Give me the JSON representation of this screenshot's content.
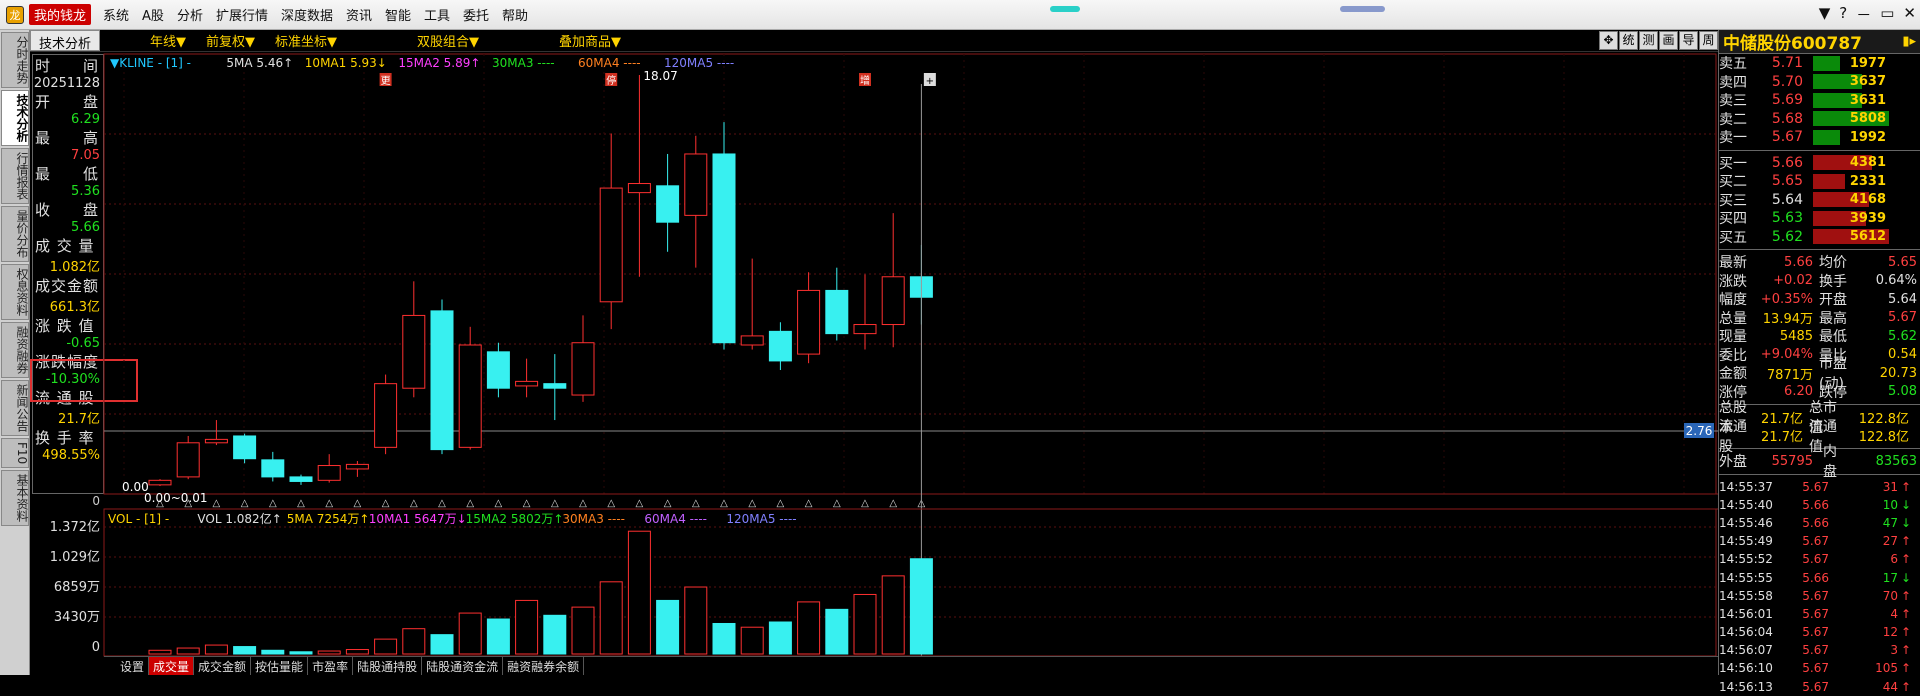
{
  "menubar": {
    "brand": "我的钱龙",
    "items": [
      "系统",
      "A股",
      "分析",
      "扩展行情",
      "深度数据",
      "资讯",
      "智能",
      "工具",
      "委托",
      "帮助"
    ],
    "window_controls": [
      "▼",
      "?",
      "－",
      "▭",
      "✕"
    ]
  },
  "sidetabs": [
    "分时走势",
    "技术分析",
    "行情报表",
    "量价分布",
    "权息资料",
    "融资融券",
    "新闻公告",
    "F10",
    "基本资料"
  ],
  "toolbar": {
    "tab": "技术分析",
    "items": [
      "年线▼",
      "前复权▼",
      "标准坐标▼",
      "双股组合▼",
      "叠加商品▼"
    ],
    "tools": [
      "✥",
      "统",
      "测",
      "画",
      "导",
      "周"
    ]
  },
  "info": [
    {
      "label": "时　　间",
      "value": "20251128",
      "color": "#e0e0e0"
    },
    {
      "label": "开　　盘",
      "value": "6.29",
      "color": "#20e020"
    },
    {
      "label": "最　　高",
      "value": "7.05",
      "color": "#ff4040"
    },
    {
      "label": "最　　低",
      "value": "5.36",
      "color": "#20e020"
    },
    {
      "label": "收　　盘",
      "value": "5.66",
      "color": "#20e020"
    },
    {
      "label": "成 交 量",
      "value": "1.082亿",
      "color": "#ffd400"
    },
    {
      "label": "成交金额",
      "value": "661.3亿",
      "color": "#ffd400"
    },
    {
      "label": "涨 跌 值",
      "value": "-0.65",
      "color": "#20e020"
    },
    {
      "label": "涨跌幅度",
      "value": "-10.30%",
      "color": "#20e020"
    },
    {
      "label": "流 通 股",
      "value": "21.7亿",
      "color": "#ffd400"
    },
    {
      "label": "换 手 率",
      "value": "498.55%",
      "color": "#ffd400"
    }
  ],
  "kline_legend": [
    {
      "text": "▼KLINE - [1] -",
      "color": "#20c8ff"
    },
    {
      "text": "5MA 5.46↑",
      "color": "#e0e0e0"
    },
    {
      "text": "10MA1 5.93↓",
      "color": "#ffd400"
    },
    {
      "text": "15MA2 5.89↑",
      "color": "#ff40ff"
    },
    {
      "text": "30MA3 ----",
      "color": "#20e020"
    },
    {
      "text": "60MA4 ----",
      "color": "#ff8020"
    },
    {
      "text": "120MA5 ----",
      "color": "#8080ff"
    }
  ],
  "vol_legend": [
    {
      "text": "VOL - [1] -",
      "color": "#ffd400"
    },
    {
      "text": "VOL 1.082亿↑",
      "color": "#e0e0e0"
    },
    {
      "text": "5MA 7254万↑",
      "color": "#ffd400"
    },
    {
      "text": "10MA1 5647万↓",
      "color": "#ff40ff"
    },
    {
      "text": "15MA2 5802万↑",
      "color": "#20e020"
    },
    {
      "text": "30MA3 ----",
      "color": "#ff8020"
    },
    {
      "text": "60MA4 ----",
      "color": "#c060ff"
    },
    {
      "text": "120MA5 ----",
      "color": "#8080ff"
    }
  ],
  "chart_data": {
    "type": "candlestick",
    "price_labels": {
      "peak": "18.07",
      "current": "2.76",
      "low": "0.00",
      "low2": "0.00~0.01",
      "axis_zero": "0"
    },
    "markers": [
      "更",
      "停",
      "增",
      "+"
    ],
    "candles": [
      {
        "o": 0.05,
        "c": 0.25,
        "h": 0.3,
        "l": 0.0
      },
      {
        "o": 0.4,
        "c": 1.9,
        "h": 2.2,
        "l": 0.3
      },
      {
        "o": 1.9,
        "c": 2.05,
        "h": 2.9,
        "l": 1.8
      },
      {
        "o": 2.2,
        "c": 1.2,
        "h": 2.3,
        "l": 1.0
      },
      {
        "o": 1.15,
        "c": 0.4,
        "h": 1.5,
        "l": 0.2
      },
      {
        "o": 0.4,
        "c": 0.2,
        "h": 0.5,
        "l": 0.05
      },
      {
        "o": 0.25,
        "c": 0.9,
        "h": 1.4,
        "l": 0.15
      },
      {
        "o": 0.75,
        "c": 0.95,
        "h": 1.1,
        "l": 0.4
      },
      {
        "o": 1.7,
        "c": 4.5,
        "h": 4.9,
        "l": 1.4
      },
      {
        "o": 4.3,
        "c": 7.5,
        "h": 9.0,
        "l": 3.9
      },
      {
        "o": 7.7,
        "c": 1.6,
        "h": 8.2,
        "l": 1.4
      },
      {
        "o": 1.7,
        "c": 6.2,
        "h": 7.0,
        "l": 1.6
      },
      {
        "o": 5.9,
        "c": 4.3,
        "h": 6.3,
        "l": 3.9
      },
      {
        "o": 4.4,
        "c": 4.6,
        "h": 5.6,
        "l": 3.9
      },
      {
        "o": 4.5,
        "c": 4.3,
        "h": 5.8,
        "l": 2.9
      },
      {
        "o": 4.0,
        "c": 6.3,
        "h": 7.5,
        "l": 3.7
      },
      {
        "o": 8.1,
        "c": 13.1,
        "h": 15.5,
        "l": 6.9
      },
      {
        "o": 12.9,
        "c": 13.3,
        "h": 18.07,
        "l": 9.2
      },
      {
        "o": 13.2,
        "c": 11.6,
        "h": 14.6,
        "l": 10.3
      },
      {
        "o": 11.9,
        "c": 14.6,
        "h": 15.4,
        "l": 9.6
      },
      {
        "o": 14.6,
        "c": 6.3,
        "h": 16.0,
        "l": 6.0
      },
      {
        "o": 6.2,
        "c": 6.6,
        "h": 10.0,
        "l": 6.0
      },
      {
        "o": 6.8,
        "c": 5.5,
        "h": 7.2,
        "l": 5.1
      },
      {
        "o": 5.8,
        "c": 8.6,
        "h": 9.4,
        "l": 5.4
      },
      {
        "o": 8.6,
        "c": 6.7,
        "h": 9.6,
        "l": 6.4
      },
      {
        "o": 6.7,
        "c": 7.1,
        "h": 9.3,
        "l": 6.0
      },
      {
        "o": 7.1,
        "c": 9.2,
        "h": 12.0,
        "l": 6.1
      },
      {
        "o": 9.2,
        "c": 8.3,
        "h": 10.6,
        "l": 7.1
      }
    ],
    "vol_axis": [
      "1.372亿",
      "1.029亿",
      "6859万",
      "3430万",
      "0"
    ],
    "volumes": [
      0.05,
      0.08,
      0.12,
      0.1,
      0.05,
      0.03,
      0.04,
      0.06,
      0.2,
      0.34,
      0.26,
      0.55,
      0.47,
      0.72,
      0.52,
      0.63,
      0.97,
      1.65,
      0.72,
      0.9,
      0.41,
      0.36,
      0.43,
      0.7,
      0.6,
      0.8,
      1.05,
      1.28
    ]
  },
  "bottomtabs": [
    "设置",
    "成交量",
    "成交金额",
    "按估量能",
    "市盈率",
    "陆股通持股",
    "陆股通资金流",
    "融资融券余额"
  ],
  "stock": {
    "name": "中储股份600787"
  },
  "orderbook_sell": [
    {
      "label": "卖五",
      "price": "5.71",
      "vol": "1977",
      "pcolor": "#ff4040",
      "w": 0.35
    },
    {
      "label": "卖四",
      "price": "5.70",
      "vol": "3637",
      "pcolor": "#ff4040",
      "w": 0.65
    },
    {
      "label": "卖三",
      "price": "5.69",
      "vol": "3631",
      "pcolor": "#ff4040",
      "w": 0.65
    },
    {
      "label": "卖二",
      "price": "5.68",
      "vol": "5808",
      "pcolor": "#ff4040",
      "w": 1.0
    },
    {
      "label": "卖一",
      "price": "5.67",
      "vol": "1992",
      "pcolor": "#ff4040",
      "w": 0.36
    }
  ],
  "orderbook_buy": [
    {
      "label": "买一",
      "price": "5.66",
      "vol": "4381",
      "pcolor": "#ff4040",
      "w": 0.78
    },
    {
      "label": "买二",
      "price": "5.65",
      "vol": "2331",
      "pcolor": "#ff4040",
      "w": 0.42
    },
    {
      "label": "买三",
      "price": "5.64",
      "vol": "4168",
      "pcolor": "#e0e0e0",
      "w": 0.74
    },
    {
      "label": "买四",
      "price": "5.63",
      "vol": "3939",
      "pcolor": "#20e020",
      "w": 0.7
    },
    {
      "label": "买五",
      "price": "5.62",
      "vol": "5612",
      "pcolor": "#20e020",
      "w": 1.0
    }
  ],
  "quote": [
    {
      "l": "最新",
      "v": "5.66",
      "vc": "#ff4040",
      "l2": "均价",
      "v2": "5.65",
      "v2c": "#ff4040"
    },
    {
      "l": "涨跌",
      "v": "+0.02",
      "vc": "#ff4040",
      "l2": "换手",
      "v2": "0.64%",
      "v2c": "#e0e0e0"
    },
    {
      "l": "幅度",
      "v": "+0.35%",
      "vc": "#ff4040",
      "l2": "开盘",
      "v2": "5.64",
      "v2c": "#e0e0e0"
    },
    {
      "l": "总量",
      "v": "13.94万",
      "vc": "#ffd400",
      "l2": "最高",
      "v2": "5.67",
      "v2c": "#ff4040"
    },
    {
      "l": "现量",
      "v": "5485",
      "vc": "#ffd400",
      "l2": "最低",
      "v2": "5.62",
      "v2c": "#20e020"
    },
    {
      "l": "委比",
      "v": "+9.04%",
      "vc": "#ff4040",
      "l2": "量比",
      "v2": "0.54",
      "v2c": "#ffd400"
    },
    {
      "l": "金额",
      "v": "7871万",
      "vc": "#ffd400",
      "l2": "市盈(动)",
      "v2": "20.73",
      "v2c": "#ffd400"
    },
    {
      "l": "涨停",
      "v": "6.20",
      "vc": "#ff4040",
      "l2": "跌停",
      "v2": "5.08",
      "v2c": "#20e020"
    }
  ],
  "shares": [
    {
      "l": "总股本",
      "v": "21.7亿",
      "l2": "总市值",
      "v2": "122.8亿"
    },
    {
      "l": "流通股",
      "v": "21.7亿",
      "l2": "流通值",
      "v2": "122.8亿"
    }
  ],
  "inout": {
    "out_label": "外盘",
    "out_val": "55795",
    "in_label": "内盘",
    "in_val": "83563"
  },
  "ticks": [
    {
      "t": "14:55:37",
      "p": "5.67",
      "v": "31",
      "up": true
    },
    {
      "t": "14:55:40",
      "p": "5.66",
      "v": "10",
      "up": false
    },
    {
      "t": "14:55:46",
      "p": "5.66",
      "v": "47",
      "up": false
    },
    {
      "t": "14:55:49",
      "p": "5.67",
      "v": "27",
      "up": true
    },
    {
      "t": "14:55:52",
      "p": "5.67",
      "v": "6",
      "up": true
    },
    {
      "t": "14:55:55",
      "p": "5.66",
      "v": "17",
      "up": false
    },
    {
      "t": "14:55:58",
      "p": "5.67",
      "v": "70",
      "up": true
    },
    {
      "t": "14:56:01",
      "p": "5.67",
      "v": "4",
      "up": true
    },
    {
      "t": "14:56:04",
      "p": "5.67",
      "v": "12",
      "up": true
    },
    {
      "t": "14:56:07",
      "p": "5.67",
      "v": "3",
      "up": true
    },
    {
      "t": "14:56:10",
      "p": "5.67",
      "v": "105",
      "up": true
    },
    {
      "t": "14:56:13",
      "p": "5.67",
      "v": "44",
      "up": true
    }
  ]
}
